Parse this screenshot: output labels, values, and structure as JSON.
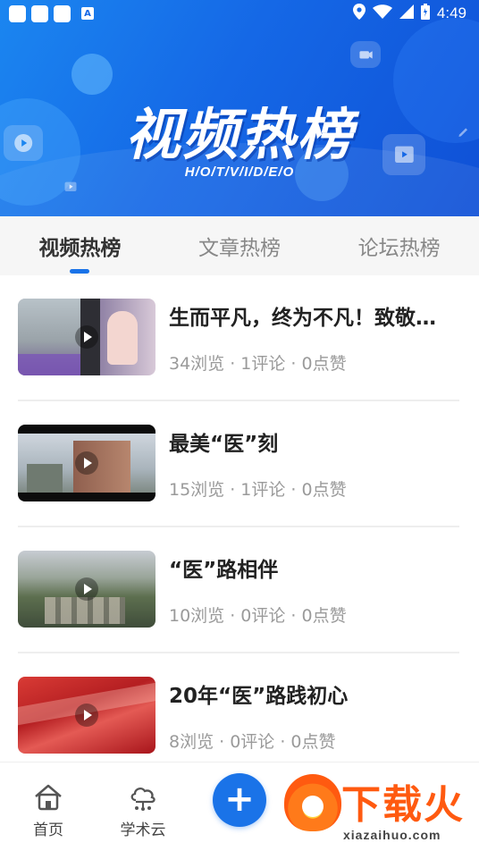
{
  "status_bar": {
    "time": "4:49",
    "icons": [
      "notification-square-icon",
      "notification-square-icon",
      "notification-square-icon",
      "app-a-icon",
      "location-icon",
      "wifi-icon",
      "signal-icon",
      "battery-icon"
    ]
  },
  "banner": {
    "title": "视频热榜",
    "subtitle": "H/O/T/V/I/D/E/O"
  },
  "tabs": [
    {
      "label": "视频热榜",
      "active": true
    },
    {
      "label": "文章热榜",
      "active": false
    },
    {
      "label": "论坛热榜",
      "active": false
    }
  ],
  "items": [
    {
      "title": "生而平凡，终为不凡！致敬最美医务工作者",
      "meta": "34浏览 · 1评论 · 0点赞"
    },
    {
      "title": "最美“医”刻",
      "meta": "15浏览 · 1评论 · 0点赞"
    },
    {
      "title": "“医”路相伴",
      "meta": "10浏览 · 0评论 · 0点赞"
    },
    {
      "title": "20年“医”路践初心",
      "meta": "8浏览 · 0评论 · 0点赞"
    }
  ],
  "bottom_nav": {
    "items": [
      {
        "label": "首页",
        "icon": "home-icon"
      },
      {
        "label": "学术云",
        "icon": "cloud-network-icon"
      }
    ],
    "fab_icon": "plus-icon"
  },
  "watermark": {
    "brand": "下载火",
    "url": "xiazaihuo.com"
  },
  "colors": {
    "accent": "#1a73e8",
    "banner_start": "#1b86f0",
    "banner_end": "#0f50d6",
    "watermark": "#ff5a10"
  }
}
